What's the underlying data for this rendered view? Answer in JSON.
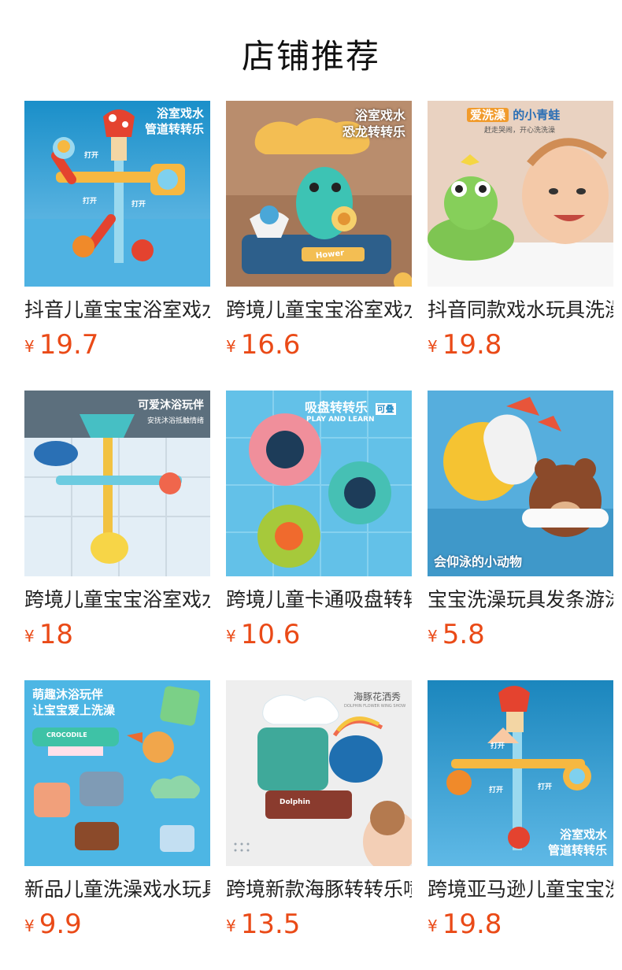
{
  "header": {
    "title": "店铺推荐"
  },
  "currency": "¥",
  "products": [
    {
      "name": "抖音儿童宝宝浴室戏水",
      "price": "19.7",
      "overlay_lines": [
        "浴室戏水",
        "管道转转乐"
      ],
      "tags": [
        "打开",
        "打开",
        "打开"
      ]
    },
    {
      "name": "跨境儿童宝宝浴室戏水",
      "price": "16.6",
      "overlay_lines": [
        "浴室戏水",
        "恐龙转转乐"
      ],
      "brand": "Hower"
    },
    {
      "name": "抖音同款戏水玩具洗澡",
      "price": "19.8",
      "overlay_lines": [
        "爱洗澡",
        "的小青蛙"
      ],
      "sub": "赶走哭闹，开心洗洗澡"
    },
    {
      "name": "跨境儿童宝宝浴室戏水",
      "price": "18",
      "overlay_lines": [
        "可爱沐浴玩伴"
      ],
      "sub": "安抚沐浴抵触情绪"
    },
    {
      "name": "跨境儿童卡通吸盘转转",
      "price": "10.6",
      "overlay_lines": [
        "吸盘转转乐",
        "可叠"
      ],
      "sub": "PLAY AND LEARN"
    },
    {
      "name": "宝宝洗澡玩具发条游泳",
      "price": "5.8",
      "overlay_lines": [
        "会仰泳的小动物"
      ]
    },
    {
      "name": "新品儿童洗澡戏水玩具",
      "price": "9.9",
      "overlay_lines": [
        "萌趣沐浴玩伴",
        "让宝宝爱上洗澡"
      ],
      "brand": "CROCODILE"
    },
    {
      "name": "跨境新款海豚转转乐喷",
      "price": "13.5",
      "overlay_lines": [
        "海豚花洒秀"
      ],
      "sub": "DOLPHIN FLOWER WING SHOW",
      "brand": "Dolphin"
    },
    {
      "name": "跨境亚马逊儿童宝宝洗",
      "price": "19.8",
      "overlay_lines": [
        "浴室戏水",
        "管道转转乐"
      ],
      "tags": [
        "打开",
        "打开",
        "打开"
      ]
    }
  ]
}
